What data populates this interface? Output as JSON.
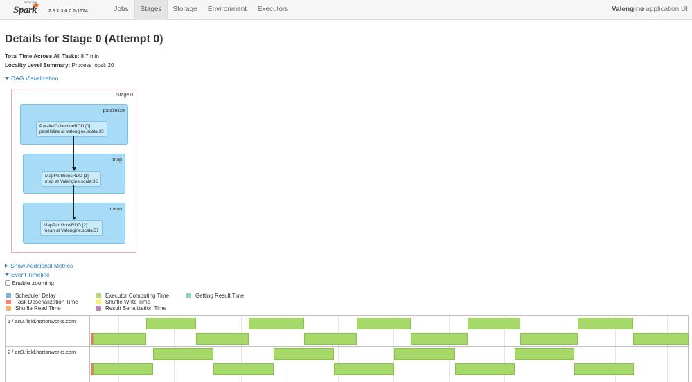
{
  "navbar": {
    "logo_apache": "APACHE",
    "logo_spark": "Spark",
    "version": "2.3.1.3.0.0.0-1574",
    "tabs": [
      {
        "label": "Jobs",
        "active": false
      },
      {
        "label": "Stages",
        "active": true
      },
      {
        "label": "Storage",
        "active": false
      },
      {
        "label": "Environment",
        "active": false
      },
      {
        "label": "Executors",
        "active": false
      }
    ],
    "app_name_bold": "Valengine",
    "app_name_suffix": " application UI"
  },
  "page_title": "Details for Stage 0 (Attempt 0)",
  "summary": {
    "total_time_label": "Total Time Across All Tasks:",
    "total_time_value": " 8.7 min",
    "locality_label": "Locality Level Summary:",
    "locality_value": " Process local: 20"
  },
  "dag": {
    "toggle_label": "DAG Visualization",
    "stage_label": "Stage 0",
    "clusters": [
      {
        "label": "parallelize",
        "node_line1": "ParallelCollectionRDD [0]",
        "node_line2": "parallelize at Valengine.scala:35"
      },
      {
        "label": "map",
        "node_line1": "MapPartitionsRDD [1]",
        "node_line2": "map at Valengine.scala:35"
      },
      {
        "label": "mean",
        "node_line1": "MapPartitionsRDD [2]",
        "node_line2": "mean at Valengine.scala:37"
      }
    ]
  },
  "additional_metrics_label": "Show Additional Metrics",
  "event_timeline": {
    "toggle_label": "Event Timeline",
    "enable_zooming_label": "Enable zooming",
    "enable_zooming_checked": false,
    "legend": [
      {
        "label": "Scheduler Delay",
        "color": "#80b1d3"
      },
      {
        "label": "Task Deserialization Time",
        "color": "#fb8072"
      },
      {
        "label": "Shuffle Read Time",
        "color": "#fdb462"
      },
      {
        "label": "Executor Computing Time",
        "color": "#b3de69"
      },
      {
        "label": "Shuffle Write Time",
        "color": "#ffed6f"
      },
      {
        "label": "Result Serialization Time",
        "color": "#bc80bd"
      },
      {
        "label": "Getting Result Time",
        "color": "#8dd3c7"
      }
    ],
    "executors": [
      {
        "label": "1 / art2.field.hortonworks.com"
      },
      {
        "label": "2 / art3.field.hortonworks.com"
      }
    ]
  }
}
